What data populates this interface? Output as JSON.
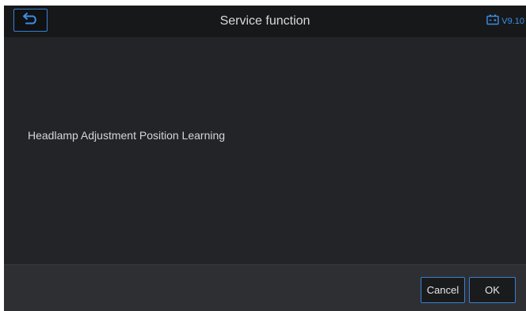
{
  "header": {
    "title": "Service function",
    "back_icon": "back-arrow-icon",
    "battery_icon": "battery-icon",
    "version": "V9.10"
  },
  "main": {
    "message": "Headlamp Adjustment Position Learning"
  },
  "footer": {
    "cancel_label": "Cancel",
    "ok_label": "OK"
  },
  "colors": {
    "accent": "#3b8fe6",
    "background": "#232427",
    "header_bg": "#17181a",
    "footer_bg": "#2e2f33"
  }
}
